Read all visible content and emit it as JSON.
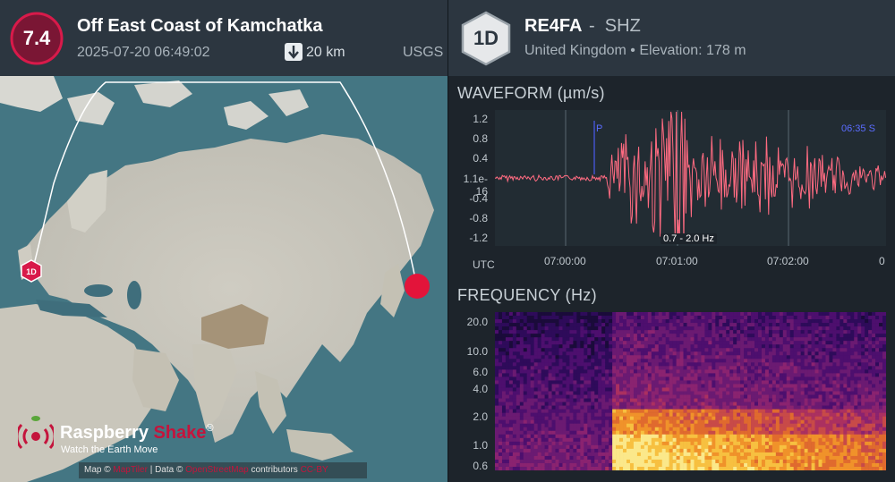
{
  "event": {
    "magnitude": "7.4",
    "title": "Off East Coast of Kamchatka",
    "datetime": "2025-07-20 06:49:02",
    "depth": "20 km",
    "source": "USGS"
  },
  "station": {
    "badge": "1D",
    "code": "RE4FA",
    "separator": "-",
    "channel": "SHZ",
    "location": "United Kingdom • Elevation: 178 m"
  },
  "map": {
    "station_marker": "1D",
    "logo": {
      "name_a": "Raspberry",
      "name_b": "Shake",
      "reg": "®",
      "tagline": "Watch the Earth Move"
    },
    "attribution": {
      "prefix": "Map ©",
      "link1": "MapTiler",
      "mid": "| Data ©",
      "link2": "OpenStreetMap",
      "suffix": "contributors",
      "link3": "CC-BY"
    }
  },
  "waveform": {
    "title": "WAVEFORM (µm/s)",
    "y_ticks": [
      "1.2",
      "0.8",
      "0.4",
      "1.1e-16",
      "-0.4",
      "-0.8",
      "-1.2"
    ],
    "x_axis_label": "UTC",
    "x_ticks": [
      "07:00:00",
      "07:01:00",
      "07:02:00",
      "0"
    ],
    "p_label": "P",
    "pick_label": "06:35  S",
    "band": "0.7 - 2.0 Hz",
    "colors": {
      "trace": "#ff6b81",
      "pick": "#4b5cf0",
      "background": "#222c33"
    }
  },
  "frequency": {
    "title": "FREQUENCY (Hz)",
    "y_ticks": [
      "20.0",
      "10.0",
      "6.0",
      "4.0",
      "2.0",
      "1.0",
      "0.6"
    ]
  }
}
